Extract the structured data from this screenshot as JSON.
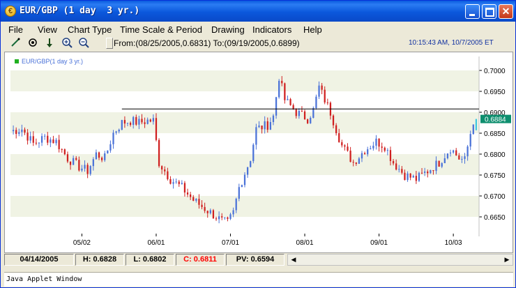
{
  "window": {
    "title": "EUR/GBP (1 day  3 yr.)",
    "footer_text": "Java Applet Window"
  },
  "menu": {
    "items": [
      "File",
      "View",
      "Chart Type",
      "Time Scale & Period",
      "Drawing",
      "Indicators",
      "Help"
    ]
  },
  "toolbar": {
    "tools": [
      "draw-line-icon",
      "crosshair-icon",
      "download-arrow-icon",
      "zoom-in-icon",
      "zoom-out-icon"
    ],
    "range_label": "From:(08/25/2005,0.6831) To:(09/19/2005,0.6899)",
    "clock": "10:15:43 AM, 10/7/2005 ET"
  },
  "status": {
    "date": "04/14/2005",
    "high": "H: 0.6828",
    "low": "L: 0.6802",
    "close": "C: 0.6811",
    "pv": "PV: 0.6594"
  },
  "colors": {
    "up_candle": "#4a72d8",
    "down_candle": "#d02020",
    "price_tag_bg": "#0e8f6f",
    "close_text": "#ff0000",
    "legend_text": "#4a72d8",
    "grid_band": "#f0f3e4"
  },
  "chart_data": {
    "type": "candlestick",
    "legend": "EUR/GBP(1 day  3 yr.)",
    "ylim": [
      0.661,
      0.703
    ],
    "y_ticks": [
      0.665,
      0.67,
      0.675,
      0.68,
      0.685,
      0.69,
      0.695,
      0.7
    ],
    "y_tick_labels": [
      "0.6650",
      "0.6700",
      "0.6750",
      "0.6800",
      "0.6850",
      "0.6900",
      "0.6950",
      "0.7000"
    ],
    "x_ticks": [
      25,
      51,
      77,
      103,
      129,
      155
    ],
    "x_tick_labels": [
      "05/02",
      "06/01",
      "07/01",
      "08/01",
      "09/01",
      "10/03"
    ],
    "x_range": [
      0,
      164
    ],
    "current_price": 0.6884,
    "current_price_label": "0.6884",
    "horizontal_line": {
      "value": 0.6908,
      "start_index": 39
    },
    "anchors": [
      [
        0,
        0.6855
      ],
      [
        4,
        0.686
      ],
      [
        8,
        0.6825
      ],
      [
        12,
        0.684
      ],
      [
        16,
        0.683
      ],
      [
        20,
        0.679
      ],
      [
        24,
        0.677
      ],
      [
        27,
        0.676
      ],
      [
        30,
        0.68
      ],
      [
        33,
        0.679
      ],
      [
        36,
        0.685
      ],
      [
        39,
        0.6875
      ],
      [
        42,
        0.688
      ],
      [
        45,
        0.6875
      ],
      [
        48,
        0.688
      ],
      [
        50,
        0.688
      ],
      [
        52,
        0.678
      ],
      [
        56,
        0.674
      ],
      [
        60,
        0.672
      ],
      [
        64,
        0.669
      ],
      [
        68,
        0.667
      ],
      [
        72,
        0.665
      ],
      [
        74,
        0.664
      ],
      [
        76,
        0.6635
      ],
      [
        78,
        0.666
      ],
      [
        80,
        0.672
      ],
      [
        84,
        0.679
      ],
      [
        86,
        0.686
      ],
      [
        90,
        0.687
      ],
      [
        92,
        0.689
      ],
      [
        94,
        0.6985
      ],
      [
        96,
        0.693
      ],
      [
        100,
        0.69
      ],
      [
        104,
        0.6885
      ],
      [
        106,
        0.6905
      ],
      [
        108,
        0.696
      ],
      [
        112,
        0.69
      ],
      [
        116,
        0.682
      ],
      [
        120,
        0.678
      ],
      [
        124,
        0.681
      ],
      [
        128,
        0.683
      ],
      [
        131,
        0.682
      ],
      [
        134,
        0.678
      ],
      [
        138,
        0.675
      ],
      [
        142,
        0.674
      ],
      [
        146,
        0.676
      ],
      [
        150,
        0.678
      ],
      [
        154,
        0.6815
      ],
      [
        157,
        0.679
      ],
      [
        159,
        0.6785
      ],
      [
        161,
        0.685
      ],
      [
        162,
        0.688
      ]
    ]
  }
}
